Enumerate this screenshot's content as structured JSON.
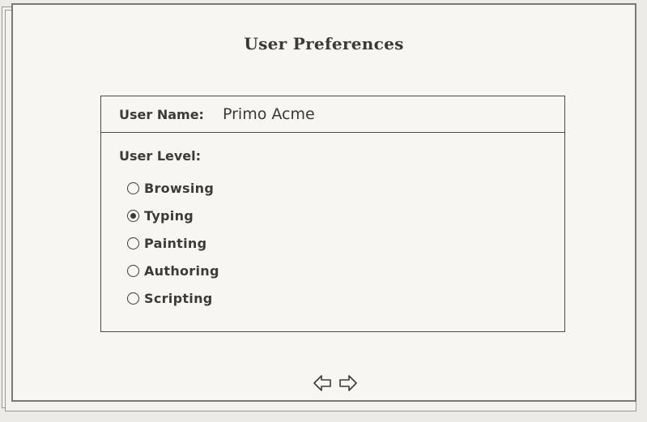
{
  "dialog": {
    "title": "User Preferences"
  },
  "user_name": {
    "label": "User Name:",
    "value": "Primo Acme"
  },
  "user_level": {
    "label": "User Level:",
    "selected": "Typing",
    "options": [
      {
        "label": "Browsing",
        "selected": false
      },
      {
        "label": "Typing",
        "selected": true
      },
      {
        "label": "Painting",
        "selected": false
      },
      {
        "label": "Authoring",
        "selected": false
      },
      {
        "label": "Scripting",
        "selected": false
      }
    ]
  },
  "navigation": {
    "prev_icon": "left-arrow-icon",
    "next_icon": "right-arrow-icon"
  },
  "colors": {
    "ink": "#3d3b38",
    "paper": "#f7f6f3"
  }
}
